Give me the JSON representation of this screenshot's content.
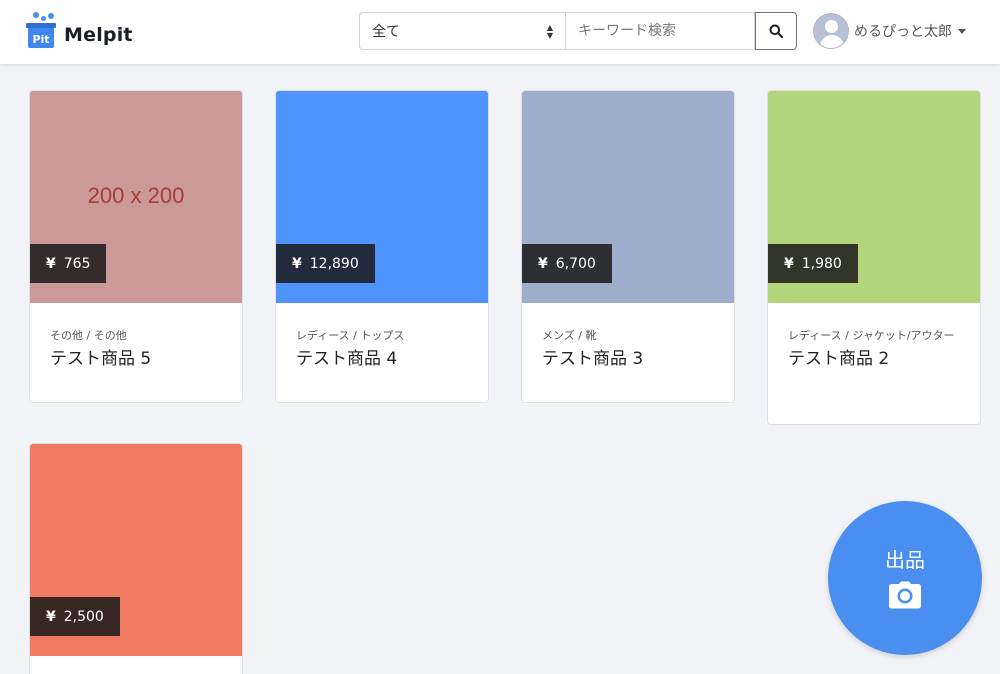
{
  "brand": {
    "name": "Melpit",
    "mark_text": "Pit",
    "color": "#4a8ef0"
  },
  "search": {
    "category_selected": "全て",
    "placeholder": "キーワード検索"
  },
  "user": {
    "name": "めるぴっと太郎"
  },
  "items": [
    {
      "category": "その他 / その他",
      "title": "テスト商品 5",
      "price": "765",
      "color": "#cc9999",
      "image_label": "200 x 200"
    },
    {
      "category": "レディース / トップス",
      "title": "テスト商品 4",
      "price": "12,890",
      "color": "#4f93fd",
      "image_label": ""
    },
    {
      "category": "メンズ / 靴",
      "title": "テスト商品 3",
      "price": "6,700",
      "color": "#9eadcb",
      "image_label": ""
    },
    {
      "category": "レディース / ジャケット/アウター",
      "title": "テスト商品 2",
      "price": "1,980",
      "color": "#b2d57c",
      "image_label": ""
    },
    {
      "category": "",
      "title": "",
      "price": "2,500",
      "color": "#ee7b62",
      "image_label": ""
    }
  ],
  "sell_button": {
    "label": "出品",
    "icon": "camera-icon"
  },
  "currency_symbol": "¥"
}
